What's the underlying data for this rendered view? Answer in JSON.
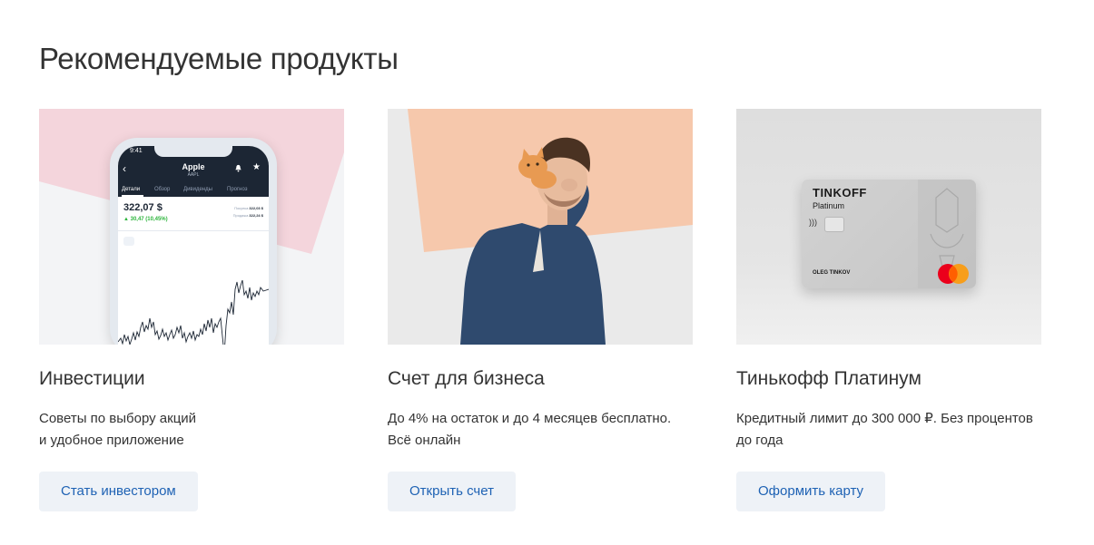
{
  "section": {
    "title": "Рекомендуемые продукты"
  },
  "cards": [
    {
      "title": "Инвестиции",
      "desc": [
        "Советы по выбору акций",
        "и удобное приложение"
      ],
      "button": "Стать инвестором",
      "phone": {
        "time": "9:41",
        "title": "Apple",
        "ticker": "AAPL",
        "tabs": [
          "Детали",
          "Обзор",
          "Дивиденды",
          "Прогноз"
        ],
        "price": "322,07 $",
        "change": "▲ 30,47 (10,45%)",
        "buy_label": "Покупка",
        "buy_value": "322,03 $",
        "sell_label": "Продажа",
        "sell_value": "322,24 $"
      }
    },
    {
      "title": "Счет для бизнеса",
      "desc": [
        "До 4% на остаток и до 4 месяцев бесплатно.",
        "Всё онлайн"
      ],
      "button": "Открыть счет"
    },
    {
      "title": "Тинькофф Платинум",
      "desc": [
        "Кредитный лимит до 300 000 ₽. Без процентов",
        "до года"
      ],
      "button": "Оформить карту",
      "card": {
        "brand": "TINKOFF",
        "tier": "Platinum",
        "holder": "OLEG TINKOV"
      }
    }
  ],
  "colors": {
    "button_bg": "#eef2f7",
    "button_text": "#1e62b4",
    "phone_header": "#1c2634",
    "positive": "#2db53c",
    "invest_pink": "#f4d5dc",
    "biz_peach": "#f6c8ac"
  }
}
